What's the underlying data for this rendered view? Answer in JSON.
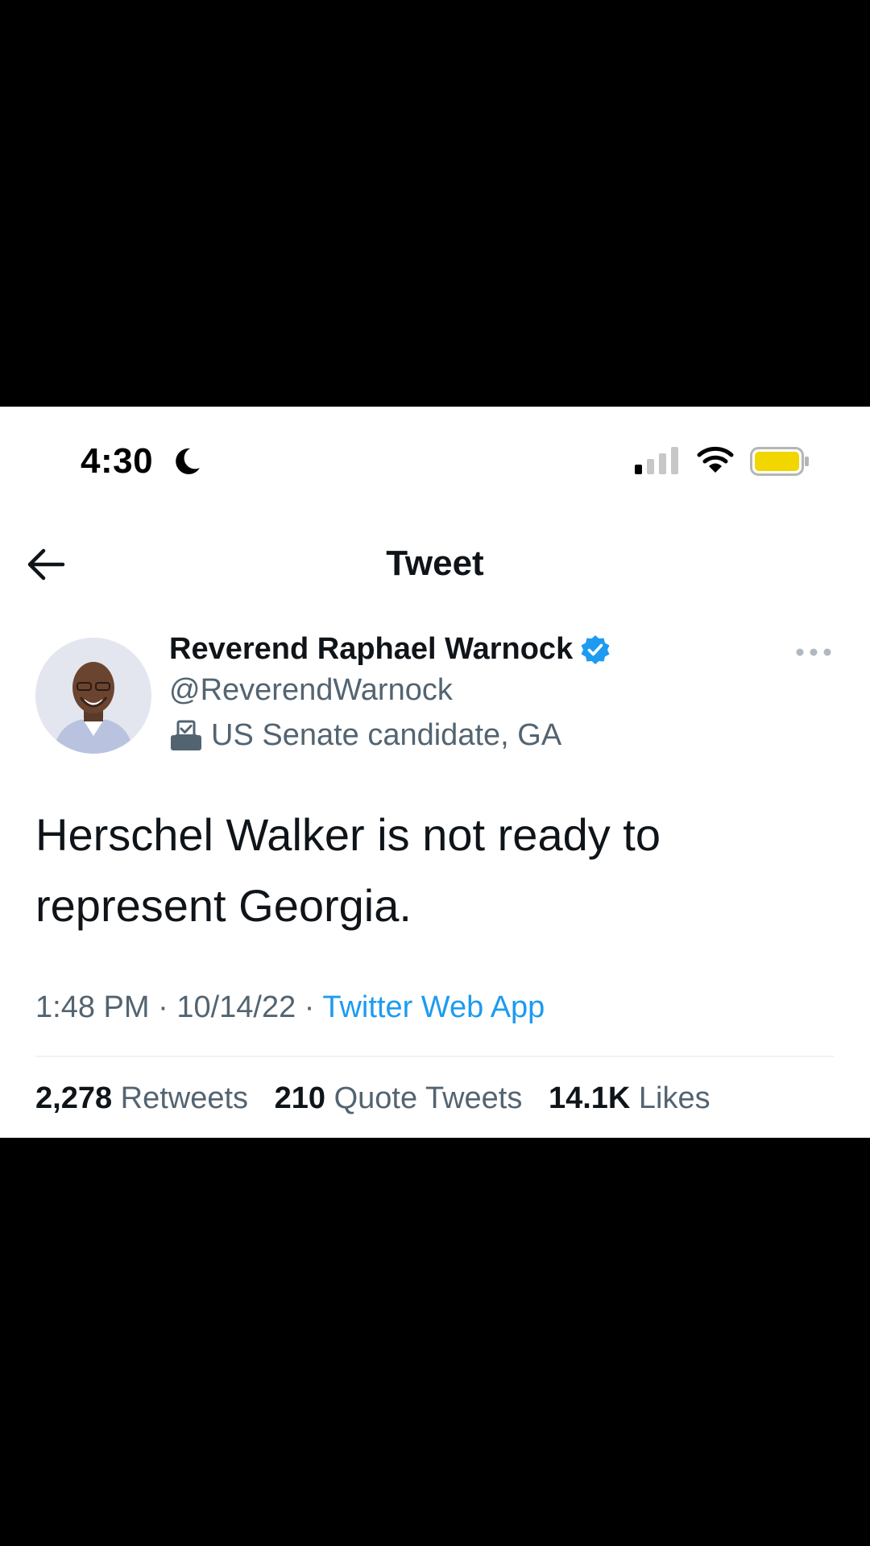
{
  "status_bar": {
    "time": "4:30"
  },
  "header": {
    "title": "Tweet"
  },
  "author": {
    "name": "Reverend Raphael Warnock",
    "handle": "@ReverendWarnock",
    "label": "US Senate candidate, GA"
  },
  "tweet": {
    "text": "Herschel Walker is not ready to represent Georgia.",
    "time": "1:48 PM",
    "separator": "·",
    "date": "10/14/22",
    "source": "Twitter Web App"
  },
  "stats": {
    "retweets_count": "2,278",
    "retweets_label": "Retweets",
    "quotes_count": "210",
    "quotes_label": "Quote Tweets",
    "likes_count": "14.1K",
    "likes_label": "Likes"
  },
  "colors": {
    "accent": "#1d9bf0",
    "battery": "#f2d600",
    "text": "#0f1419",
    "secondary": "#536471"
  }
}
